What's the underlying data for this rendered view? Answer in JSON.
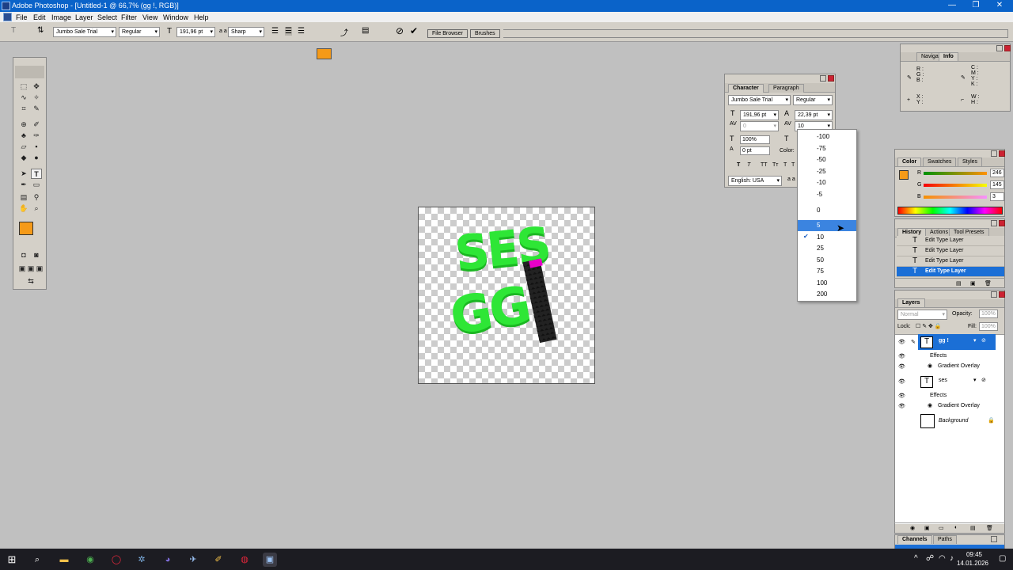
{
  "window": {
    "title": "Adobe Photoshop - [Untitled-1 @ 66,7% (gg !, RGB)]",
    "min": "—",
    "max": "❐",
    "close": "✕"
  },
  "menu": [
    "File",
    "Edit",
    "Image",
    "Layer",
    "Select",
    "Filter",
    "View",
    "Window",
    "Help"
  ],
  "options": {
    "font_family": "Jumbo Sale Trial",
    "font_style": "Regular",
    "font_size": "191,96 pt",
    "aa_prefix": "a a",
    "antialias": "Sharp",
    "color": "#f59a18",
    "file_browser": "File Browser",
    "brushes": "Brushes"
  },
  "canvas": {
    "text_top": "SES",
    "text_bottom": "GG!",
    "text_color": "#2ee636"
  },
  "character": {
    "tabs": [
      "Character",
      "Paragraph"
    ],
    "font_family": "Jumbo Sale Trial",
    "font_style": "Regular",
    "size": "191,96 pt",
    "leading": "22,39 pt",
    "kerning": "0",
    "tracking": "10",
    "vscale": "100%",
    "baseline": "0 pt",
    "color_label": "Color:",
    "language": "English: USA",
    "aa": "a a",
    "styles": [
      "T",
      "T",
      "TT",
      "Tт",
      "T",
      "T",
      "T"
    ]
  },
  "tracking_options": [
    "-100",
    "-75",
    "-50",
    "-25",
    "-10",
    "-5",
    "0",
    "5",
    "10",
    "25",
    "50",
    "75",
    "100",
    "200"
  ],
  "tracking_highlight": "5",
  "tracking_checked": "10",
  "navigator": {
    "tabs": [
      "Navigator",
      "Info"
    ],
    "rgb": [
      "R :",
      "G :",
      "B :"
    ],
    "cmyk": [
      "C :",
      "M :",
      "Y :",
      "K :"
    ],
    "xy": [
      "X :",
      "Y :"
    ],
    "wh": [
      "W :",
      "H :"
    ]
  },
  "color_panel": {
    "tabs": [
      "Color",
      "Swatches",
      "Styles"
    ],
    "r_label": "R",
    "g_label": "G",
    "b_label": "B",
    "r": "246",
    "g": "145",
    "b": "3",
    "fg": "#f59a18",
    "bg": "#33cc44"
  },
  "history": {
    "tabs": [
      "History",
      "Actions",
      "Tool Presets"
    ],
    "items": [
      "Edit Type Layer",
      "Edit Type Layer",
      "Edit Type Layer",
      "Edit Type Layer"
    ]
  },
  "layers": {
    "title": "Layers",
    "mode": "Normal",
    "opacity_label": "Opacity:",
    "opacity": "100%",
    "lock_label": "Lock:",
    "fill_label": "Fill:",
    "fill": "100%",
    "rows": [
      {
        "name": "gg !",
        "effects": "Effects",
        "fx": "Gradient Overlay"
      },
      {
        "name": "ses",
        "effects": "Effects",
        "fx": "Gradient Overlay"
      }
    ],
    "background": "Background"
  },
  "channels": {
    "tabs": [
      "Channels",
      "Paths"
    ]
  },
  "taskbar": {
    "time": "09:45",
    "date": "14.01.2026"
  }
}
